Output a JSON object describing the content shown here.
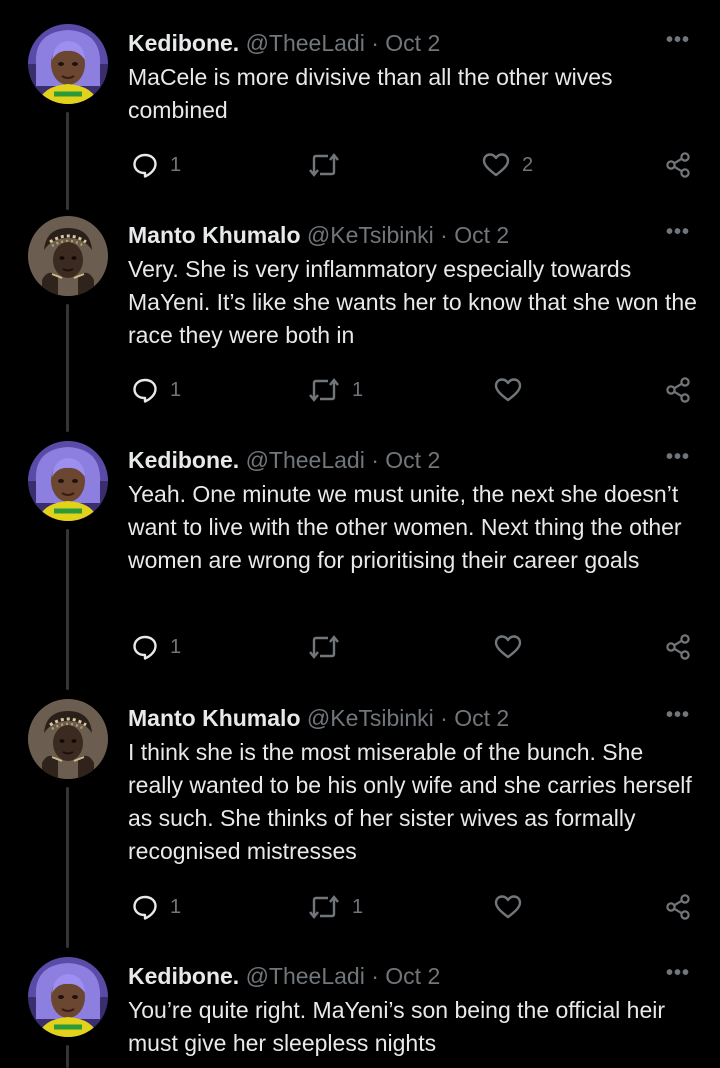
{
  "tweets": [
    {
      "name": "Kedibone.",
      "handle": "@TheeLadi",
      "date": "Oct 2",
      "text": "MaCele is more divisive than all the other wives combined",
      "replies": "1",
      "retweets": "",
      "likes": "2",
      "avatar": "kedibone"
    },
    {
      "name": "Manto Khumalo",
      "handle": "@KeTsibinki",
      "date": "Oct 2",
      "text": "Very. She is very inflammatory especially towards MaYeni. It’s like she wants her to know that she won the race they were both in",
      "replies": "1",
      "retweets": "1",
      "likes": "",
      "avatar": "manto"
    },
    {
      "name": "Kedibone.",
      "handle": "@TheeLadi",
      "date": "Oct 2",
      "text": "Yeah. One minute we must unite, the next she doesn’t want to live with the other women. Next thing the other women are wrong for prioritising their career goals",
      "replies": "1",
      "retweets": "",
      "likes": "",
      "avatar": "kedibone"
    },
    {
      "name": "Manto Khumalo",
      "handle": "@KeTsibinki",
      "date": "Oct 2",
      "text": "I think she is the most miserable of the bunch. She really wanted to be his only wife and she carries herself as such. She thinks of her sister wives as formally recognised mistresses",
      "replies": "1",
      "retweets": "1",
      "likes": "",
      "avatar": "manto"
    },
    {
      "name": "Kedibone.",
      "handle": "@TheeLadi",
      "date": "Oct 2",
      "text": "You’re quite right. MaYeni’s son being the official heir must give her sleepless nights",
      "replies": "",
      "retweets": "",
      "likes": "",
      "avatar": "kedibone"
    }
  ],
  "ui": {
    "separator": " · ",
    "more": "•••"
  },
  "colors": {
    "background": "#000000",
    "primary_text": "#e7e9ea",
    "secondary_text": "#71767b",
    "thread_line": "#333639"
  },
  "icons": [
    "reply-icon",
    "retweet-icon",
    "like-icon",
    "share-icon",
    "more-icon"
  ]
}
